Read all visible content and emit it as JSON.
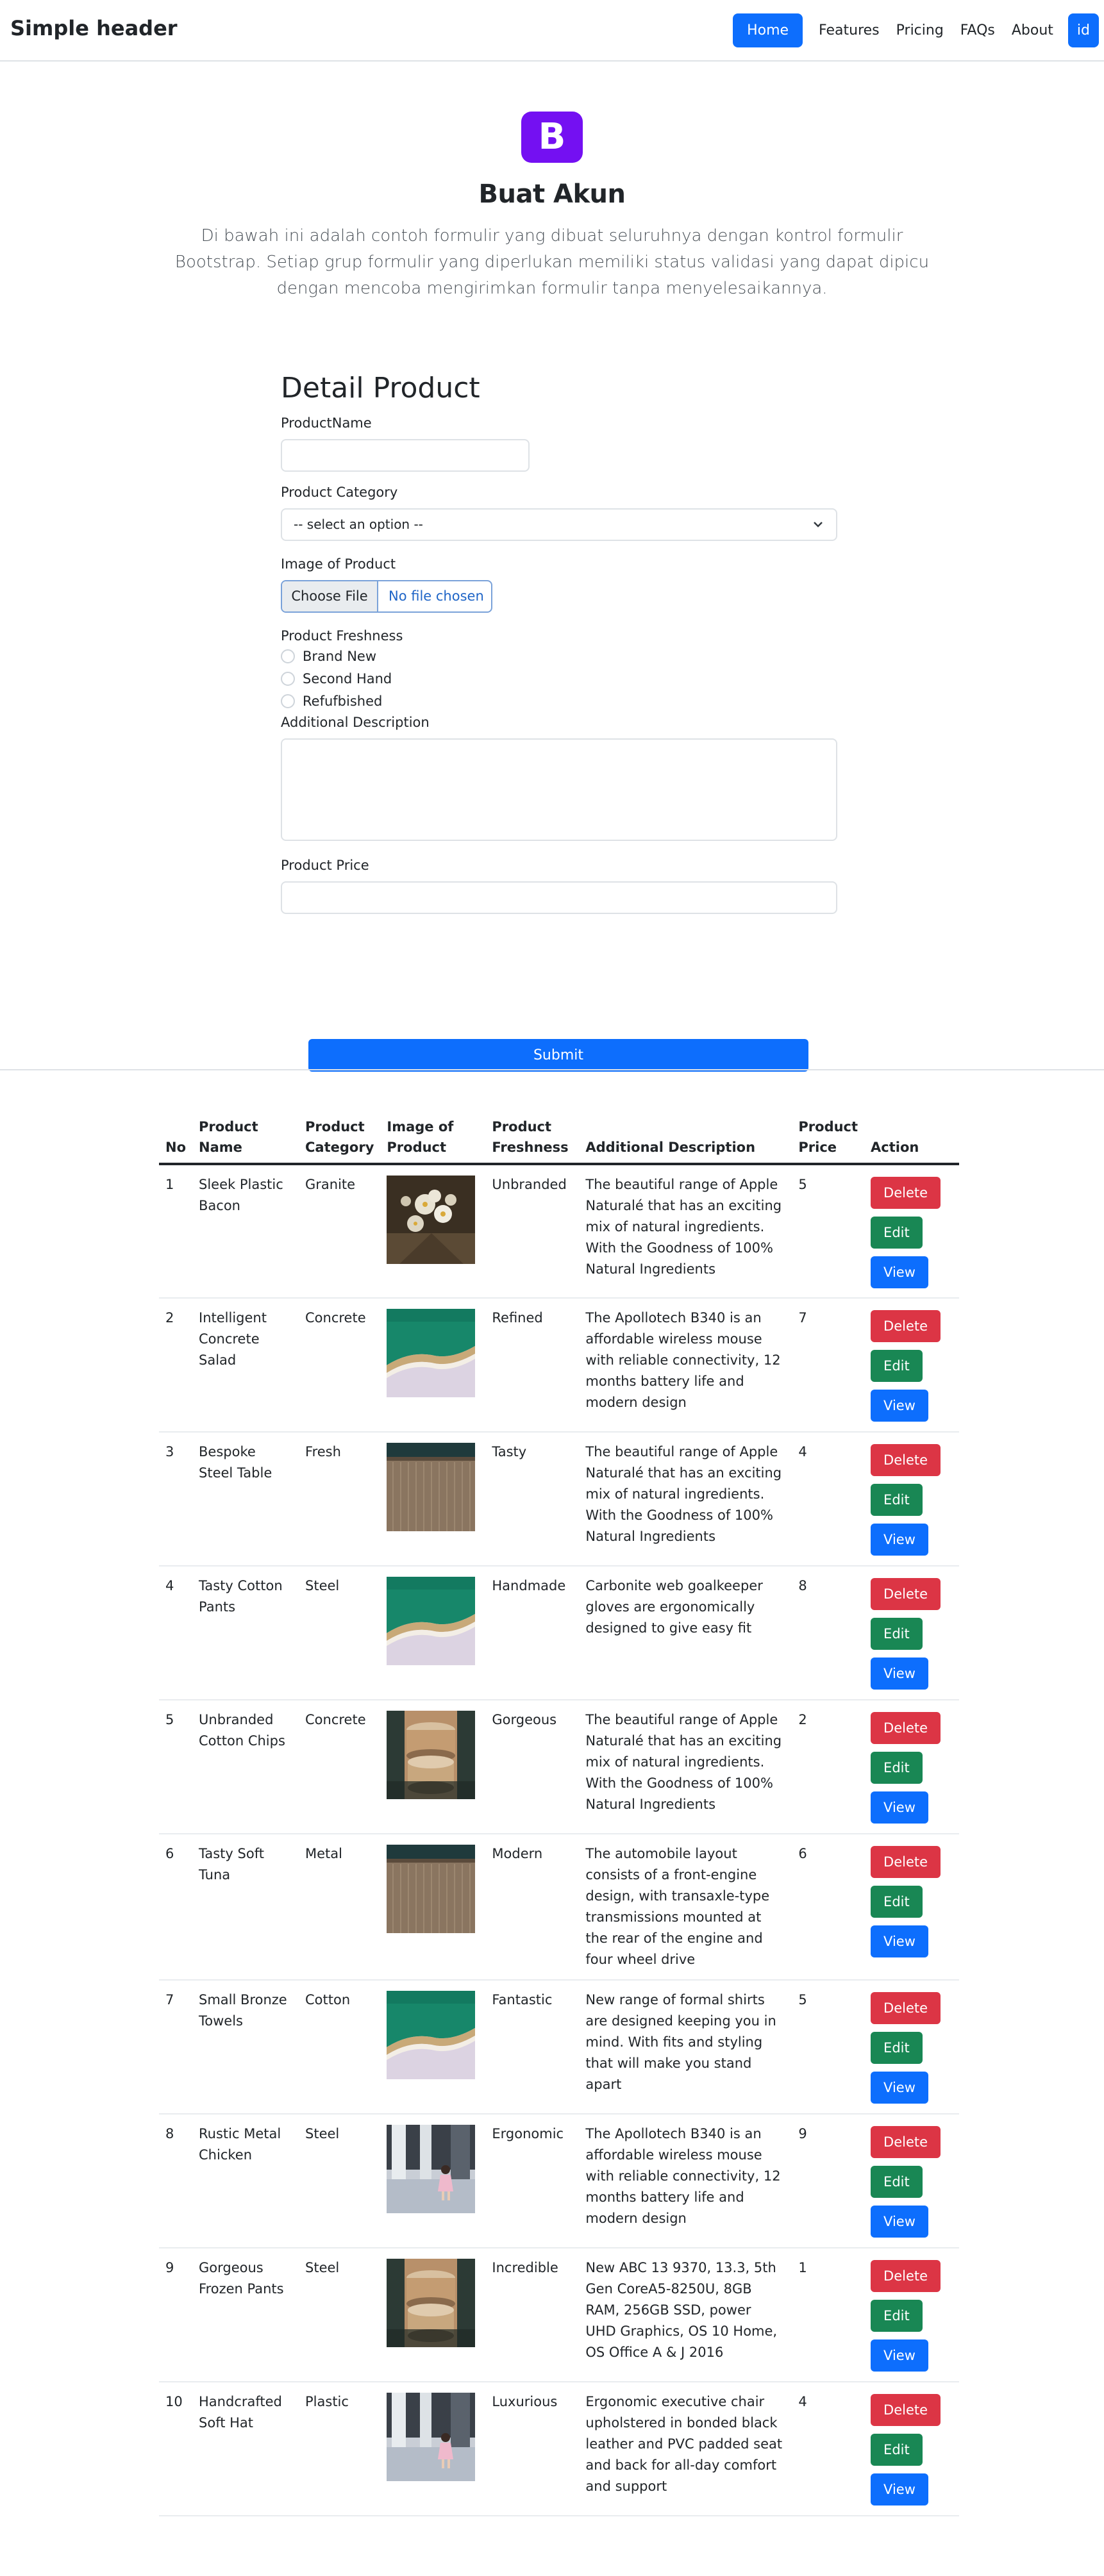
{
  "header": {
    "brand": "Simple header",
    "nav": [
      "Home",
      "Features",
      "Pricing",
      "FAQs",
      "About"
    ],
    "account": "id"
  },
  "hero": {
    "logo": "B",
    "title": "Buat Akun",
    "description": "Di bawah ini adalah contoh formulir yang dibuat seluruhnya dengan kontrol formulir Bootstrap. Setiap grup formulir yang diperlukan memiliki status validasi yang dapat dipicu dengan mencoba mengirimkan formulir tanpa menyelesaikannya."
  },
  "form": {
    "title": "Detail Product",
    "product_name_label": "ProductName",
    "product_name_value": "",
    "category_label": "Product Category",
    "category_selected": "-- select an option --",
    "image_label": "Image of Product",
    "choose_file": "Choose File",
    "no_file": "No file chosen",
    "freshness_label": "Product Freshness",
    "freshness_options": [
      "Brand New",
      "Second Hand",
      "Refufbished"
    ],
    "description_label": "Additional Description",
    "price_label": "Product Price",
    "submit": "Submit"
  },
  "table": {
    "headers": {
      "no": "No",
      "name": [
        "Product",
        "Name"
      ],
      "category": [
        "Product",
        "Category"
      ],
      "image": [
        "Image of",
        "Product"
      ],
      "freshness": [
        "Product",
        "Freshness"
      ],
      "description": "Additional Description",
      "price": [
        "Product",
        "Price"
      ],
      "action": "Action"
    },
    "actions": {
      "delete": "Delete",
      "edit": "Edit",
      "view": "View"
    },
    "rows": [
      {
        "no": "1",
        "name": "Sleek Plastic Bacon",
        "category": "Granite",
        "image": "flowers",
        "freshness": "Unbranded",
        "description": "The beautiful range of Apple Naturalé that has an exciting mix of natural ingredients. With the Goodness of 100% Natural Ingredients",
        "price": "5"
      },
      {
        "no": "2",
        "name": "Intelligent Concrete Salad",
        "category": "Concrete",
        "image": "beach",
        "freshness": "Refined",
        "description": "The Apollotech B340 is an affordable wireless mouse with reliable connectivity, 12 months battery life and modern design",
        "price": "7"
      },
      {
        "no": "3",
        "name": "Bespoke Steel Table",
        "category": "Fresh",
        "image": "wall",
        "freshness": "Tasty",
        "description": "The beautiful range of Apple Naturalé that has an exciting mix of natural ingredients. With the Goodness of 100% Natural Ingredients",
        "price": "4"
      },
      {
        "no": "4",
        "name": "Tasty Cotton Pants",
        "category": "Steel",
        "image": "beach",
        "freshness": "Handmade",
        "description": "Carbonite web goalkeeper gloves are ergonomically designed to give easy fit",
        "price": "8"
      },
      {
        "no": "5",
        "name": "Unbranded Cotton Chips",
        "category": "Concrete",
        "image": "jars",
        "freshness": "Gorgeous",
        "description": "The beautiful range of Apple Naturalé that has an exciting mix of natural ingredients. With the Goodness of 100% Natural Ingredients",
        "price": "2"
      },
      {
        "no": "6",
        "name": "Tasty Soft Tuna",
        "category": "Metal",
        "image": "wall",
        "freshness": "Modern",
        "description": "The automobile layout consists of a front-engine design, with transaxle-type transmissions mounted at the rear of the engine and four wheel drive",
        "price": "6"
      },
      {
        "no": "7",
        "name": "Small Bronze Towels",
        "category": "Cotton",
        "image": "beach",
        "freshness": "Fantastic",
        "description": "New range of formal shirts are designed keeping you in mind. With fits and styling that will make you stand apart",
        "price": "5"
      },
      {
        "no": "8",
        "name": "Rustic Metal Chicken",
        "category": "Steel",
        "image": "child",
        "freshness": "Ergonomic",
        "description": "The Apollotech B340 is an affordable wireless mouse with reliable connectivity, 12 months battery life and modern design",
        "price": "9"
      },
      {
        "no": "9",
        "name": "Gorgeous Frozen Pants",
        "category": "Steel",
        "image": "jars",
        "freshness": "Incredible",
        "description": "New ABC 13 9370, 13.3, 5th Gen CoreA5-8250U, 8GB RAM, 256GB SSD, power UHD Graphics, OS 10 Home, OS Office A & J 2016",
        "price": "1"
      },
      {
        "no": "10",
        "name": "Handcrafted Soft Hat",
        "category": "Plastic",
        "image": "child",
        "freshness": "Luxurious",
        "description": "Ergonomic executive chair upholstered in bonded black leather and PVC padded seat and back for all-day comfort and support",
        "price": "4"
      }
    ]
  },
  "colors": {
    "primary": "#0d6efd",
    "danger": "#dc3545",
    "success": "#198754",
    "logo": "#7410f2"
  }
}
